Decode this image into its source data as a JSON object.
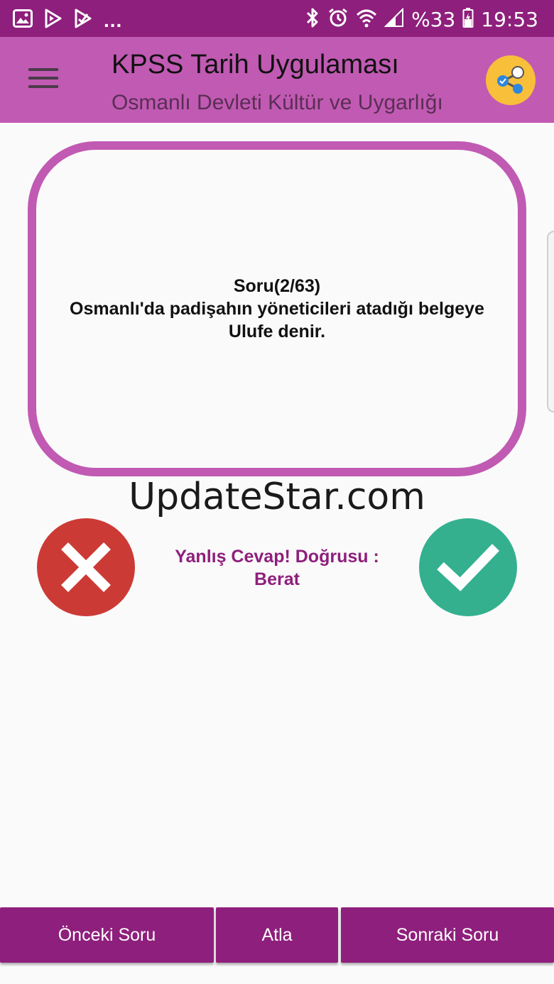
{
  "status_bar": {
    "battery": "%33",
    "time": "19:53",
    "overflow": "...",
    "icons": [
      "gallery-icon",
      "play-store-icon",
      "play-store-icon",
      "bluetooth-icon",
      "alarm-icon",
      "wifi-icon",
      "signal-icon",
      "battery-charging-icon"
    ]
  },
  "app_bar": {
    "title": "KPSS Tarih Uygulaması",
    "subtitle": "Osmanlı Devleti Kültür ve Uygarlığı",
    "menu_icon": "hamburger-menu-icon",
    "share_icon": "share-icon",
    "share_color": "#f7bf3a"
  },
  "question": {
    "counter": "Soru(2/63)",
    "text": "Osmanlı'da padişahın yöneticileri atadığı belgeye Ulufe denir."
  },
  "watermark": "UpdateStar.com",
  "answers": {
    "wrong_icon": "close-icon",
    "wrong_color": "#cc3a35",
    "correct_icon": "checkmark-icon",
    "correct_color": "#34b08f"
  },
  "feedback": {
    "line1": "Yanlış Cevap! Doğrusu :",
    "line2": "Berat"
  },
  "navigation": {
    "previous": "Önceki Soru",
    "skip": "Atla",
    "next": "Sonraki Soru"
  },
  "colors": {
    "primary_dark": "#8e1f7c",
    "primary": "#c15ab3"
  }
}
